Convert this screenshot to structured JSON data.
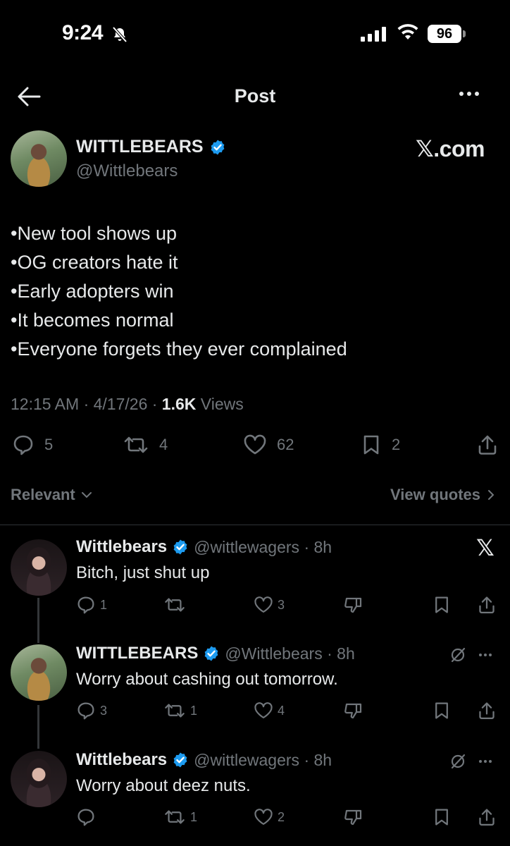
{
  "status_bar": {
    "time": "9:24",
    "battery": "96"
  },
  "nav": {
    "title": "Post"
  },
  "post": {
    "author_name": "WITTLEBEARS",
    "author_handle": "@Wittlebears",
    "watermark": "𝕏.com",
    "lines": [
      "•New tool shows up",
      "•OG creators hate it",
      "•Early adopters win",
      "•It becomes normal",
      "•Everyone forgets they ever complained"
    ],
    "meta_time": "12:15 AM · 4/17/26 · ",
    "views_count": "1.6K",
    "views_label": " Views",
    "replies": "5",
    "reposts": "4",
    "likes": "62",
    "bookmarks": "2"
  },
  "filter": {
    "label": "Relevant",
    "quotes_label": "View quotes"
  },
  "replies": [
    {
      "name": "Wittlebears",
      "handle": "@wittlewagers · 8h",
      "text": "Bitch, just shut up",
      "replies": "1",
      "reposts": "",
      "likes": "3"
    },
    {
      "name": "WITTLEBEARS",
      "handle": "@Wittlebears · 8h",
      "text": "Worry about cashing out tomorrow.",
      "replies": "3",
      "reposts": "1",
      "likes": "4"
    },
    {
      "name": "Wittlebears",
      "handle": "@wittlewagers · 8h",
      "text": "Worry about deez nuts.",
      "replies": "",
      "reposts": "1",
      "likes": "2"
    }
  ],
  "colors": {
    "background": "#000000",
    "text": "#e7e9ea",
    "muted": "#71767b",
    "verified": "#1d9bf0",
    "divider": "#2f3336"
  }
}
